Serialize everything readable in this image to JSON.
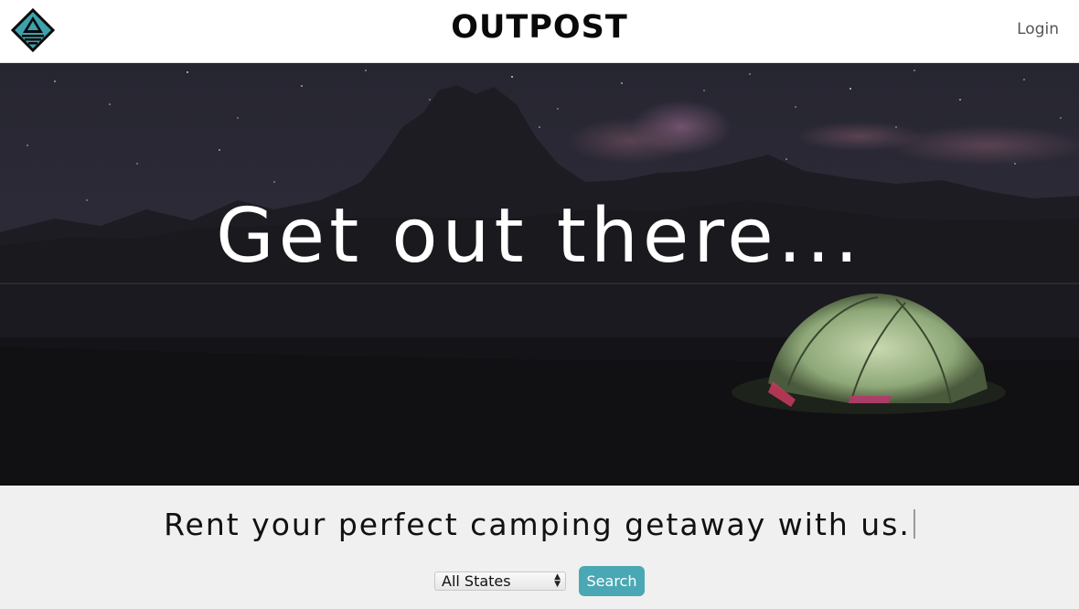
{
  "header": {
    "logo_icon": "triangle-diamond-logo-icon",
    "brand": "OUTPOST",
    "login_label": "Login"
  },
  "hero": {
    "headline": "Get out there..."
  },
  "tagline": {
    "text": "Rent your perfect camping getaway with us."
  },
  "search": {
    "state_select": {
      "selected": "All States"
    },
    "button_label": "Search"
  },
  "colors": {
    "accent": "#4aa8b4",
    "logo_fill": "#3ea1ac",
    "hero_bg": "#141318",
    "section_bg": "#f0f0f0"
  }
}
